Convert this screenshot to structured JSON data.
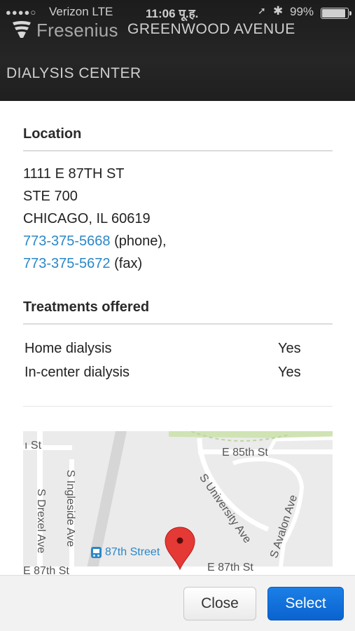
{
  "status_bar": {
    "signal": "●●●●○",
    "carrier": "Verizon  LTE",
    "time": "11:06 पू.ह.",
    "location_icon": "location-arrow-icon",
    "bluetooth_icon": "bluetooth-icon",
    "battery_percent": "99%",
    "battery_level": 0.99
  },
  "header": {
    "logo_text": "Fresenius",
    "title_line1": "GREENWOOD AVENUE",
    "title_line2": "DIALYSIS CENTER",
    "background": "#222222"
  },
  "location": {
    "heading": "Location",
    "address_line1": "1111 E 87TH ST",
    "address_line2": "STE 700",
    "address_line3": "CHICAGO, IL 60619",
    "phone": "773-375-5668",
    "phone_suffix": " (phone),",
    "fax": "773-375-5672",
    "fax_suffix": " (fax)"
  },
  "treatments": {
    "heading": "Treatments offered",
    "rows": [
      {
        "name": "Home dialysis",
        "value": "Yes"
      },
      {
        "name": "In-center dialysis",
        "value": "Yes"
      }
    ]
  },
  "map": {
    "labels": {
      "st_partial": "ı St",
      "e85": "E 85th St",
      "inglesside": "S Ingleside Ave",
      "drexel": "S Drexel Ave",
      "university": "S University Ave",
      "avalon": "S Avalon Ave",
      "station": "87th Street",
      "e87_left": "E 87th St",
      "e87_right": "E 87th St"
    },
    "pin_color": "#e53935",
    "link_color": "#2a87c8"
  },
  "actions": {
    "close_label": "Close",
    "select_label": "Select",
    "select_color": "#0a6bd9"
  }
}
